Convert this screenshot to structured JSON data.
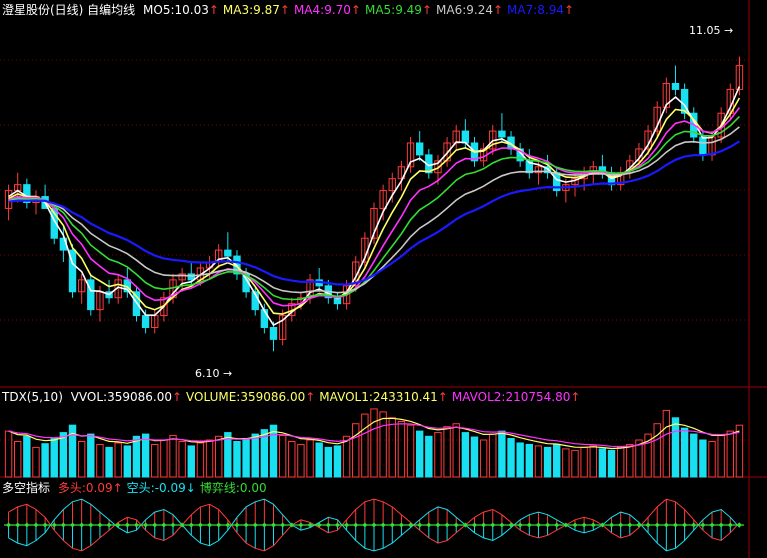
{
  "colors": {
    "background": "#000000",
    "up": "#ff3b3b",
    "down": "#18e0f0",
    "grid": "#7a0000",
    "ma_white": "#ffffff",
    "ma_yellow": "#ffff66",
    "ma_magenta": "#ff33ff",
    "ma_green": "#33dd33",
    "ma_grey": "#c8c8c8",
    "ma_blue": "#1a1aff",
    "arrow_up": "#ff3b3b",
    "arrow_down": "#18e0f0"
  },
  "header_main": {
    "title": "澄星股份(日线) 自编均线",
    "items": [
      {
        "label": "MO5:10.03",
        "color": "#ffffff",
        "arrow": "↑"
      },
      {
        "label": "MA3:9.87",
        "color": "#ffff66",
        "arrow": "↑"
      },
      {
        "label": "MA4:9.70",
        "color": "#ff33ff",
        "arrow": "↑"
      },
      {
        "label": "MA5:9.49",
        "color": "#33dd33",
        "arrow": "↑"
      },
      {
        "label": "MA6:9.24",
        "color": "#c8c8c8",
        "arrow": "↑"
      },
      {
        "label": "MA7:8.94",
        "color": "#1a1aff",
        "arrow": "↑"
      }
    ]
  },
  "header_volume": {
    "title": "TDX(5,10)",
    "items": [
      {
        "label": "VVOL:359086.00",
        "color": "#ffffff",
        "arrow": "↑"
      },
      {
        "label": "VOLUME:359086.00",
        "color": "#ffff66",
        "arrow": "↑"
      },
      {
        "label": "MAVOL1:243310.41",
        "color": "#ffff66",
        "arrow": "↑"
      },
      {
        "label": "MAVOL2:210754.80",
        "color": "#ff33ff",
        "arrow": "↑"
      }
    ]
  },
  "header_indicator": {
    "title": "多空指标",
    "items": [
      {
        "label": "多头:0.09",
        "color": "#ff3b3b",
        "arrow": "↑"
      },
      {
        "label": "空头:-0.09",
        "color": "#18e0f0",
        "arrow": "↓"
      },
      {
        "label": "博弈线:0.00",
        "color": "#33dd33",
        "arrow": ""
      }
    ]
  },
  "annotations": {
    "high": "11.05",
    "low": "6.10"
  },
  "chart_data": [
    {
      "type": "candlestick",
      "title": "澄星股份(日线)",
      "ylim": [
        5.5,
        11.7
      ],
      "candles": [
        [
          8.5,
          8.9,
          8.3,
          8.8
        ],
        [
          8.8,
          9.1,
          8.6,
          8.9
        ],
        [
          8.9,
          9.0,
          8.5,
          8.6
        ],
        [
          8.6,
          8.8,
          8.4,
          8.7
        ],
        [
          8.7,
          8.9,
          8.5,
          8.5
        ],
        [
          8.5,
          8.6,
          7.9,
          8.0
        ],
        [
          8.0,
          8.2,
          7.6,
          7.8
        ],
        [
          7.8,
          7.9,
          7.0,
          7.1
        ],
        [
          7.1,
          7.4,
          6.9,
          7.3
        ],
        [
          7.3,
          7.4,
          6.7,
          6.8
        ],
        [
          6.8,
          7.2,
          6.6,
          7.1
        ],
        [
          7.1,
          7.3,
          6.9,
          7.0
        ],
        [
          7.0,
          7.4,
          6.9,
          7.3
        ],
        [
          7.3,
          7.5,
          7.0,
          7.1
        ],
        [
          7.1,
          7.2,
          6.6,
          6.7
        ],
        [
          6.7,
          6.8,
          6.4,
          6.5
        ],
        [
          6.5,
          6.8,
          6.4,
          6.7
        ],
        [
          6.7,
          7.1,
          6.6,
          7.0
        ],
        [
          7.0,
          7.4,
          6.9,
          7.3
        ],
        [
          7.3,
          7.5,
          7.1,
          7.4
        ],
        [
          7.4,
          7.6,
          7.2,
          7.3
        ],
        [
          7.3,
          7.6,
          7.2,
          7.5
        ],
        [
          7.5,
          7.7,
          7.3,
          7.6
        ],
        [
          7.6,
          7.9,
          7.5,
          7.8
        ],
        [
          7.8,
          8.1,
          7.6,
          7.7
        ],
        [
          7.7,
          7.8,
          7.3,
          7.4
        ],
        [
          7.4,
          7.5,
          7.0,
          7.1
        ],
        [
          7.1,
          7.2,
          6.7,
          6.8
        ],
        [
          6.8,
          6.9,
          6.4,
          6.5
        ],
        [
          6.5,
          6.6,
          6.1,
          6.3
        ],
        [
          6.3,
          6.8,
          6.2,
          6.7
        ],
        [
          6.7,
          7.0,
          6.6,
          6.9
        ],
        [
          6.9,
          7.1,
          6.8,
          7.0
        ],
        [
          7.0,
          7.4,
          6.9,
          7.3
        ],
        [
          7.3,
          7.5,
          7.1,
          7.2
        ],
        [
          7.2,
          7.3,
          6.9,
          7.0
        ],
        [
          7.0,
          7.1,
          6.8,
          6.9
        ],
        [
          6.9,
          7.3,
          6.8,
          7.2
        ],
        [
          7.2,
          7.7,
          7.1,
          7.6
        ],
        [
          7.6,
          8.1,
          7.5,
          8.0
        ],
        [
          8.0,
          8.6,
          7.9,
          8.5
        ],
        [
          8.5,
          8.9,
          8.3,
          8.8
        ],
        [
          8.8,
          9.1,
          8.6,
          9.0
        ],
        [
          9.0,
          9.3,
          8.8,
          9.2
        ],
        [
          9.2,
          9.7,
          9.1,
          9.6
        ],
        [
          9.6,
          9.8,
          9.3,
          9.4
        ],
        [
          9.4,
          9.5,
          9.0,
          9.1
        ],
        [
          9.1,
          9.4,
          8.9,
          9.3
        ],
        [
          9.3,
          9.7,
          9.2,
          9.6
        ],
        [
          9.6,
          9.9,
          9.5,
          9.8
        ],
        [
          9.8,
          10.0,
          9.5,
          9.6
        ],
        [
          9.6,
          9.7,
          9.2,
          9.3
        ],
        [
          9.3,
          9.6,
          9.2,
          9.5
        ],
        [
          9.5,
          9.9,
          9.4,
          9.8
        ],
        [
          9.8,
          10.1,
          9.6,
          9.7
        ],
        [
          9.7,
          9.8,
          9.4,
          9.5
        ],
        [
          9.5,
          9.6,
          9.2,
          9.3
        ],
        [
          9.3,
          9.5,
          9.0,
          9.1
        ],
        [
          9.1,
          9.3,
          8.9,
          9.2
        ],
        [
          9.2,
          9.4,
          9.0,
          9.1
        ],
        [
          9.1,
          9.2,
          8.7,
          8.8
        ],
        [
          8.8,
          9.0,
          8.6,
          8.9
        ],
        [
          8.9,
          9.1,
          8.7,
          9.0
        ],
        [
          9.0,
          9.2,
          8.8,
          9.1
        ],
        [
          9.1,
          9.3,
          8.9,
          9.2
        ],
        [
          9.2,
          9.4,
          9.0,
          9.1
        ],
        [
          9.1,
          9.2,
          8.8,
          8.9
        ],
        [
          8.9,
          9.2,
          8.8,
          9.1
        ],
        [
          9.1,
          9.4,
          9.0,
          9.3
        ],
        [
          9.3,
          9.6,
          9.2,
          9.5
        ],
        [
          9.5,
          9.9,
          9.4,
          9.8
        ],
        [
          9.8,
          10.3,
          9.7,
          10.2
        ],
        [
          10.2,
          10.7,
          10.1,
          10.6
        ],
        [
          10.6,
          10.9,
          10.4,
          10.5
        ],
        [
          10.5,
          10.6,
          10.0,
          10.1
        ],
        [
          10.1,
          10.2,
          9.6,
          9.7
        ],
        [
          9.7,
          9.8,
          9.3,
          9.4
        ],
        [
          9.4,
          9.8,
          9.3,
          9.7
        ],
        [
          9.7,
          10.2,
          9.6,
          10.1
        ],
        [
          10.1,
          10.6,
          10.0,
          10.5
        ],
        [
          10.5,
          11.05,
          10.4,
          10.9
        ]
      ],
      "moving_averages": [
        "MO5",
        "MA3",
        "MA4",
        "MA5",
        "MA6",
        "MA7"
      ]
    },
    {
      "type": "bar",
      "title": "TDX(5,10)",
      "volumes": [
        62,
        48,
        55,
        40,
        45,
        52,
        60,
        70,
        48,
        58,
        44,
        40,
        46,
        42,
        55,
        58,
        44,
        50,
        56,
        48,
        42,
        46,
        50,
        55,
        60,
        48,
        52,
        58,
        64,
        70,
        56,
        48,
        44,
        50,
        46,
        40,
        42,
        55,
        72,
        85,
        92,
        88,
        80,
        75,
        70,
        62,
        55,
        60,
        68,
        72,
        60,
        54,
        50,
        58,
        62,
        52,
        46,
        44,
        42,
        40,
        44,
        38,
        36,
        40,
        42,
        38,
        36,
        40,
        44,
        50,
        58,
        72,
        90,
        80,
        66,
        58,
        50,
        48,
        56,
        62,
        70
      ],
      "ylim": [
        0,
        100
      ]
    },
    {
      "type": "bar",
      "title": "多空指标",
      "values": [
        0.5,
        0.7,
        0.8,
        0.6,
        0.3,
        -0.2,
        -0.6,
        -0.9,
        -1.0,
        -0.8,
        -0.5,
        -0.2,
        0.1,
        0.3,
        0.2,
        -0.2,
        -0.5,
        -0.6,
        -0.4,
        0.0,
        0.4,
        0.7,
        0.8,
        0.6,
        0.2,
        -0.3,
        -0.7,
        -0.9,
        -1.0,
        -0.8,
        -0.4,
        0.0,
        0.2,
        0.1,
        -0.1,
        -0.3,
        -0.2,
        0.2,
        0.6,
        0.9,
        1.0,
        0.9,
        0.7,
        0.4,
        0.1,
        -0.2,
        -0.5,
        -0.7,
        -0.6,
        -0.3,
        0.0,
        0.3,
        0.5,
        0.6,
        0.4,
        0.1,
        -0.2,
        -0.4,
        -0.5,
        -0.4,
        -0.2,
        0.0,
        0.2,
        0.3,
        0.2,
        0.0,
        -0.3,
        -0.5,
        -0.4,
        -0.1,
        0.3,
        0.7,
        1.0,
        0.9,
        0.6,
        0.2,
        -0.2,
        -0.5,
        -0.6,
        -0.3,
        0.09
      ],
      "ylim": [
        -1.2,
        1.2
      ]
    }
  ]
}
